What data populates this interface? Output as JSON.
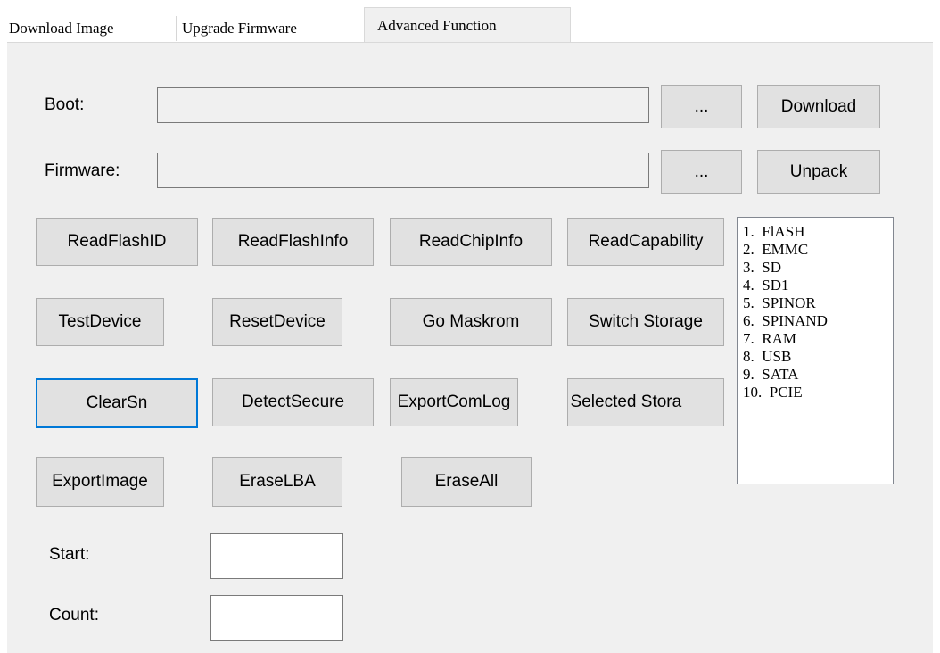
{
  "tabs": [
    {
      "label": "Download Image",
      "active": false
    },
    {
      "label": "Upgrade Firmware",
      "active": false
    },
    {
      "label": "Advanced Function",
      "active": true
    }
  ],
  "boot": {
    "label": "Boot:",
    "value": "",
    "browse_label": "...",
    "action_label": "Download"
  },
  "firmware": {
    "label": "Firmware:",
    "value": "",
    "browse_label": "...",
    "action_label": "Unpack"
  },
  "buttons": {
    "read_flash_id": "ReadFlashID",
    "read_flash_info": "ReadFlashInfo",
    "read_chip_info": "ReadChipInfo",
    "read_capability": "ReadCapability",
    "test_device": "TestDevice",
    "reset_device": "ResetDevice",
    "go_maskrom": "Go Maskrom",
    "switch_storage": "Switch Storage",
    "clear_sn": "ClearSn",
    "detect_secure": "DetectSecure",
    "export_com_log": "ExportComLog",
    "get_selected_storage": "t Selected Stora",
    "export_image": "ExportImage",
    "erase_lba": "EraseLBA",
    "erase_all": "EraseAll"
  },
  "storage_list": [
    "1.  FlASH",
    "2.  EMMC",
    "3.  SD",
    "4.  SD1",
    "5.  SPINOR",
    "6.  SPINAND",
    "7.  RAM",
    "8.  USB",
    "9.  SATA",
    "10.  PCIE"
  ],
  "start": {
    "label": "Start:",
    "value": ""
  },
  "count": {
    "label": "Count:",
    "value": ""
  },
  "colors": {
    "focus_border": "#0078d7",
    "panel_bg": "#f0f0f0",
    "button_bg": "#e1e1e1"
  }
}
